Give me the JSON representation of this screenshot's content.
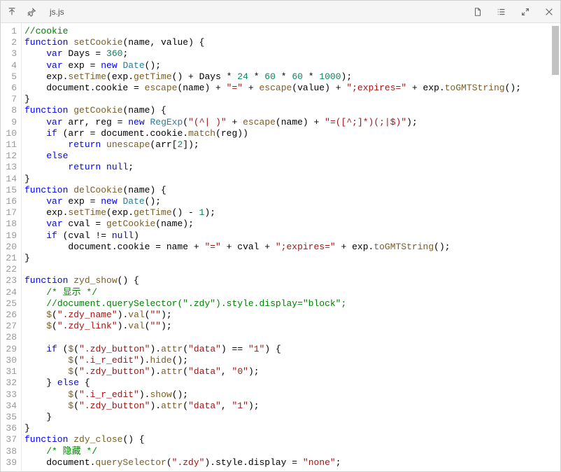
{
  "titlebar": {
    "filename": "js.js"
  },
  "code": {
    "lines": [
      {
        "n": 1,
        "t": [
          [
            "c-comment",
            "//cookie"
          ]
        ]
      },
      {
        "n": 2,
        "t": [
          [
            "c-kw",
            "function"
          ],
          [
            "",
            " "
          ],
          [
            "c-fn",
            "setCookie"
          ],
          [
            "c-op",
            "(name, value) {"
          ]
        ]
      },
      {
        "n": 3,
        "t": [
          [
            "",
            "    "
          ],
          [
            "c-kw",
            "var"
          ],
          [
            "",
            " Days = "
          ],
          [
            "c-num",
            "360"
          ],
          [
            "c-op",
            ";"
          ]
        ]
      },
      {
        "n": 4,
        "t": [
          [
            "",
            "    "
          ],
          [
            "c-kw",
            "var"
          ],
          [
            "",
            " exp = "
          ],
          [
            "c-kw",
            "new"
          ],
          [
            "",
            " "
          ],
          [
            "c-type",
            "Date"
          ],
          [
            "c-op",
            "();"
          ]
        ]
      },
      {
        "n": 5,
        "t": [
          [
            "",
            "    exp."
          ],
          [
            "c-fn",
            "setTime"
          ],
          [
            "c-op",
            "(exp."
          ],
          [
            "c-fn",
            "getTime"
          ],
          [
            "c-op",
            "() + Days * "
          ],
          [
            "c-num",
            "24"
          ],
          [
            "c-op",
            " * "
          ],
          [
            "c-num",
            "60"
          ],
          [
            "c-op",
            " * "
          ],
          [
            "c-num",
            "60"
          ],
          [
            "c-op",
            " * "
          ],
          [
            "c-num",
            "1000"
          ],
          [
            "c-op",
            ");"
          ]
        ]
      },
      {
        "n": 6,
        "t": [
          [
            "",
            "    document.cookie = "
          ],
          [
            "c-fn",
            "escape"
          ],
          [
            "c-op",
            "(name) + "
          ],
          [
            "c-str",
            "\"=\""
          ],
          [
            "c-op",
            " + "
          ],
          [
            "c-fn",
            "escape"
          ],
          [
            "c-op",
            "(value) + "
          ],
          [
            "c-str",
            "\";expires=\""
          ],
          [
            "c-op",
            " + exp."
          ],
          [
            "c-fn",
            "toGMTString"
          ],
          [
            "c-op",
            "();"
          ]
        ]
      },
      {
        "n": 7,
        "t": [
          [
            "c-op",
            "}"
          ]
        ]
      },
      {
        "n": 8,
        "t": [
          [
            "c-kw",
            "function"
          ],
          [
            "",
            " "
          ],
          [
            "c-fn",
            "getCookie"
          ],
          [
            "c-op",
            "(name) {"
          ]
        ]
      },
      {
        "n": 9,
        "t": [
          [
            "",
            "    "
          ],
          [
            "c-kw",
            "var"
          ],
          [
            "",
            " arr, reg = "
          ],
          [
            "c-kw",
            "new"
          ],
          [
            "",
            " "
          ],
          [
            "c-type",
            "RegExp"
          ],
          [
            "c-op",
            "("
          ],
          [
            "c-str",
            "\"(^| )\""
          ],
          [
            "c-op",
            " + "
          ],
          [
            "c-fn",
            "escape"
          ],
          [
            "c-op",
            "(name) + "
          ],
          [
            "c-str",
            "\"=([^;]*)(;|$)\""
          ],
          [
            "c-op",
            ");"
          ]
        ]
      },
      {
        "n": 10,
        "t": [
          [
            "",
            "    "
          ],
          [
            "c-kw",
            "if"
          ],
          [
            "c-op",
            " (arr = document.cookie."
          ],
          [
            "c-fn",
            "match"
          ],
          [
            "c-op",
            "(reg))"
          ]
        ]
      },
      {
        "n": 11,
        "t": [
          [
            "",
            "        "
          ],
          [
            "c-kw",
            "return"
          ],
          [
            "",
            " "
          ],
          [
            "c-fn",
            "unescape"
          ],
          [
            "c-op",
            "(arr["
          ],
          [
            "c-num",
            "2"
          ],
          [
            "c-op",
            "]);"
          ]
        ]
      },
      {
        "n": 12,
        "t": [
          [
            "",
            "    "
          ],
          [
            "c-kw",
            "else"
          ]
        ]
      },
      {
        "n": 13,
        "t": [
          [
            "",
            "        "
          ],
          [
            "c-kw",
            "return"
          ],
          [
            "",
            " "
          ],
          [
            "c-kw",
            "null"
          ],
          [
            "c-op",
            ";"
          ]
        ]
      },
      {
        "n": 14,
        "t": [
          [
            "c-op",
            "}"
          ]
        ]
      },
      {
        "n": 15,
        "t": [
          [
            "c-kw",
            "function"
          ],
          [
            "",
            " "
          ],
          [
            "c-fn",
            "delCookie"
          ],
          [
            "c-op",
            "(name) {"
          ]
        ]
      },
      {
        "n": 16,
        "t": [
          [
            "",
            "    "
          ],
          [
            "c-kw",
            "var"
          ],
          [
            "",
            " exp = "
          ],
          [
            "c-kw",
            "new"
          ],
          [
            "",
            " "
          ],
          [
            "c-type",
            "Date"
          ],
          [
            "c-op",
            "();"
          ]
        ]
      },
      {
        "n": 17,
        "t": [
          [
            "",
            "    exp."
          ],
          [
            "c-fn",
            "setTime"
          ],
          [
            "c-op",
            "(exp."
          ],
          [
            "c-fn",
            "getTime"
          ],
          [
            "c-op",
            "() - "
          ],
          [
            "c-num",
            "1"
          ],
          [
            "c-op",
            ");"
          ]
        ]
      },
      {
        "n": 18,
        "t": [
          [
            "",
            "    "
          ],
          [
            "c-kw",
            "var"
          ],
          [
            "",
            " cval = "
          ],
          [
            "c-fn",
            "getCookie"
          ],
          [
            "c-op",
            "(name);"
          ]
        ]
      },
      {
        "n": 19,
        "t": [
          [
            "",
            "    "
          ],
          [
            "c-kw",
            "if"
          ],
          [
            "c-op",
            " (cval != "
          ],
          [
            "c-kw",
            "null"
          ],
          [
            "c-op",
            ")"
          ]
        ]
      },
      {
        "n": 20,
        "t": [
          [
            "",
            "        document.cookie = name + "
          ],
          [
            "c-str",
            "\"=\""
          ],
          [
            "c-op",
            " + cval + "
          ],
          [
            "c-str",
            "\";expires=\""
          ],
          [
            "c-op",
            " + exp."
          ],
          [
            "c-fn",
            "toGMTString"
          ],
          [
            "c-op",
            "();"
          ]
        ]
      },
      {
        "n": 21,
        "t": [
          [
            "c-op",
            "}"
          ]
        ]
      },
      {
        "n": 22,
        "t": [
          [
            "",
            ""
          ]
        ]
      },
      {
        "n": 23,
        "t": [
          [
            "c-kw",
            "function"
          ],
          [
            "",
            " "
          ],
          [
            "c-fn",
            "zyd_show"
          ],
          [
            "c-op",
            "() {"
          ]
        ]
      },
      {
        "n": 24,
        "t": [
          [
            "",
            "    "
          ],
          [
            "c-comment",
            "/* 显示 */"
          ]
        ]
      },
      {
        "n": 25,
        "t": [
          [
            "",
            "    "
          ],
          [
            "c-comment",
            "//document.querySelector(\".zdy\").style.display=\"block\";"
          ]
        ]
      },
      {
        "n": 26,
        "t": [
          [
            "",
            "    "
          ],
          [
            "c-fn",
            "$"
          ],
          [
            "c-op",
            "("
          ],
          [
            "c-str",
            "\".zdy_name\""
          ],
          [
            "c-op",
            ")."
          ],
          [
            "c-fn",
            "val"
          ],
          [
            "c-op",
            "("
          ],
          [
            "c-str",
            "\"\""
          ],
          [
            "c-op",
            ");"
          ]
        ]
      },
      {
        "n": 27,
        "t": [
          [
            "",
            "    "
          ],
          [
            "c-fn",
            "$"
          ],
          [
            "c-op",
            "("
          ],
          [
            "c-str",
            "\".zdy_link\""
          ],
          [
            "c-op",
            ")."
          ],
          [
            "c-fn",
            "val"
          ],
          [
            "c-op",
            "("
          ],
          [
            "c-str",
            "\"\""
          ],
          [
            "c-op",
            ");"
          ]
        ]
      },
      {
        "n": 28,
        "t": [
          [
            "",
            ""
          ]
        ]
      },
      {
        "n": 29,
        "t": [
          [
            "",
            "    "
          ],
          [
            "c-kw",
            "if"
          ],
          [
            "c-op",
            " ("
          ],
          [
            "c-fn",
            "$"
          ],
          [
            "c-op",
            "("
          ],
          [
            "c-str",
            "\".zdy_button\""
          ],
          [
            "c-op",
            ")."
          ],
          [
            "c-fn",
            "attr"
          ],
          [
            "c-op",
            "("
          ],
          [
            "c-str",
            "\"data\""
          ],
          [
            "c-op",
            ") == "
          ],
          [
            "c-str",
            "\"1\""
          ],
          [
            "c-op",
            ") {"
          ]
        ]
      },
      {
        "n": 30,
        "t": [
          [
            "",
            "        "
          ],
          [
            "c-fn",
            "$"
          ],
          [
            "c-op",
            "("
          ],
          [
            "c-str",
            "\".i_r_edit\""
          ],
          [
            "c-op",
            ")."
          ],
          [
            "c-fn",
            "hide"
          ],
          [
            "c-op",
            "();"
          ]
        ]
      },
      {
        "n": 31,
        "t": [
          [
            "",
            "        "
          ],
          [
            "c-fn",
            "$"
          ],
          [
            "c-op",
            "("
          ],
          [
            "c-str",
            "\".zdy_button\""
          ],
          [
            "c-op",
            ")."
          ],
          [
            "c-fn",
            "attr"
          ],
          [
            "c-op",
            "("
          ],
          [
            "c-str",
            "\"data\""
          ],
          [
            "c-op",
            ", "
          ],
          [
            "c-str",
            "\"0\""
          ],
          [
            "c-op",
            ");"
          ]
        ]
      },
      {
        "n": 32,
        "t": [
          [
            "",
            "    } "
          ],
          [
            "c-kw",
            "else"
          ],
          [
            "c-op",
            " {"
          ]
        ]
      },
      {
        "n": 33,
        "t": [
          [
            "",
            "        "
          ],
          [
            "c-fn",
            "$"
          ],
          [
            "c-op",
            "("
          ],
          [
            "c-str",
            "\".i_r_edit\""
          ],
          [
            "c-op",
            ")."
          ],
          [
            "c-fn",
            "show"
          ],
          [
            "c-op",
            "();"
          ]
        ]
      },
      {
        "n": 34,
        "t": [
          [
            "",
            "        "
          ],
          [
            "c-fn",
            "$"
          ],
          [
            "c-op",
            "("
          ],
          [
            "c-str",
            "\".zdy_button\""
          ],
          [
            "c-op",
            ")."
          ],
          [
            "c-fn",
            "attr"
          ],
          [
            "c-op",
            "("
          ],
          [
            "c-str",
            "\"data\""
          ],
          [
            "c-op",
            ", "
          ],
          [
            "c-str",
            "\"1\""
          ],
          [
            "c-op",
            ");"
          ]
        ]
      },
      {
        "n": 35,
        "t": [
          [
            "",
            "    }"
          ]
        ]
      },
      {
        "n": 36,
        "t": [
          [
            "c-op",
            "}"
          ]
        ]
      },
      {
        "n": 37,
        "t": [
          [
            "c-kw",
            "function"
          ],
          [
            "",
            " "
          ],
          [
            "c-fn",
            "zdy_close"
          ],
          [
            "c-op",
            "() {"
          ]
        ]
      },
      {
        "n": 38,
        "t": [
          [
            "",
            "    "
          ],
          [
            "c-comment",
            "/* 隐藏 */"
          ]
        ]
      },
      {
        "n": 39,
        "t": [
          [
            "",
            "    document."
          ],
          [
            "c-fn",
            "querySelector"
          ],
          [
            "c-op",
            "("
          ],
          [
            "c-str",
            "\".zdy\""
          ],
          [
            "c-op",
            ").style.display = "
          ],
          [
            "c-str",
            "\"none\""
          ],
          [
            "c-op",
            ";"
          ]
        ]
      }
    ]
  }
}
